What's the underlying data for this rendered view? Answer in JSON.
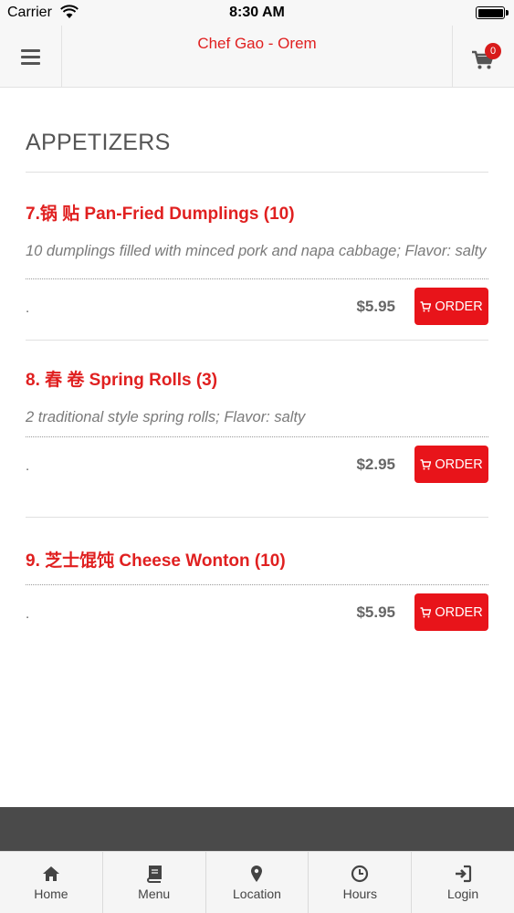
{
  "status_bar": {
    "carrier": "Carrier",
    "time": "8:30 AM"
  },
  "header": {
    "title": "Chef Gao - Orem",
    "cart_count": "0"
  },
  "section": {
    "title": "APPETIZERS"
  },
  "items": [
    {
      "name": "7.锅 贴 Pan-Fried Dumplings (10)",
      "description": "10 dumplings filled with minced pork and napa cabbage; Flavor: salty",
      "dot": ".",
      "price": "$5.95",
      "order_label": "ORDER"
    },
    {
      "name": "8. 春 卷 Spring Rolls (3)",
      "description": "2 traditional style spring rolls; Flavor: salty",
      "dot": ".",
      "price": "$2.95",
      "order_label": "ORDER"
    },
    {
      "name": "9. 芝士馄饨 Cheese Wonton (10)",
      "description": "",
      "dot": ".",
      "price": "$5.95",
      "order_label": "ORDER"
    }
  ],
  "nav": [
    {
      "label": "Home",
      "icon": "home-icon"
    },
    {
      "label": "Menu",
      "icon": "book-icon"
    },
    {
      "label": "Location",
      "icon": "map-pin-icon"
    },
    {
      "label": "Hours",
      "icon": "clock-icon"
    },
    {
      "label": "Login",
      "icon": "login-icon"
    }
  ],
  "colors": {
    "accent": "#e02020",
    "button": "#e8141a",
    "footer": "#4a4a4a"
  }
}
